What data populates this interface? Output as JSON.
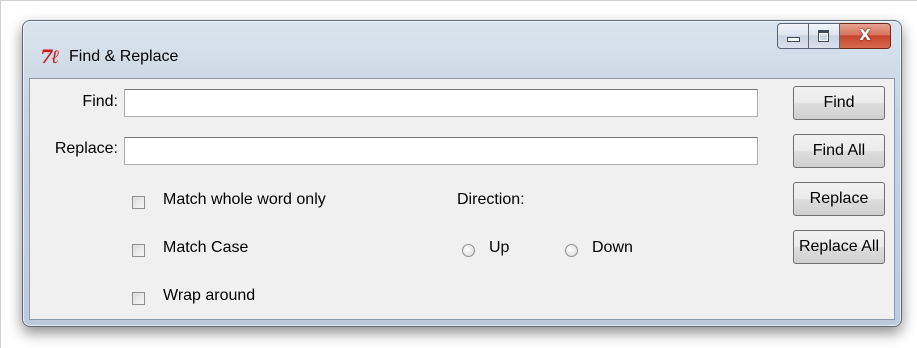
{
  "window": {
    "title": "Find & Replace",
    "icon": "tk-feather-icon",
    "controls": {
      "minimize": "minimize-icon",
      "maximize": "maximize-icon",
      "close": "X"
    }
  },
  "form": {
    "find_label": "Find:",
    "find_value": "",
    "replace_label": "Replace:",
    "replace_value": ""
  },
  "options": {
    "match_whole_word": {
      "label": "Match whole word only",
      "checked": false
    },
    "match_case": {
      "label": "Match Case",
      "checked": false
    },
    "wrap_around": {
      "label": "Wrap around",
      "checked": false
    }
  },
  "direction": {
    "label": "Direction:",
    "up_label": "Up",
    "down_label": "Down",
    "selected": ""
  },
  "buttons": {
    "find": "Find",
    "find_all": "Find All",
    "replace": "Replace",
    "replace_all": "Replace All"
  },
  "colors": {
    "close_button": "#c7452b",
    "app_icon": "#d01818",
    "client_bg": "#f0f0f0"
  }
}
